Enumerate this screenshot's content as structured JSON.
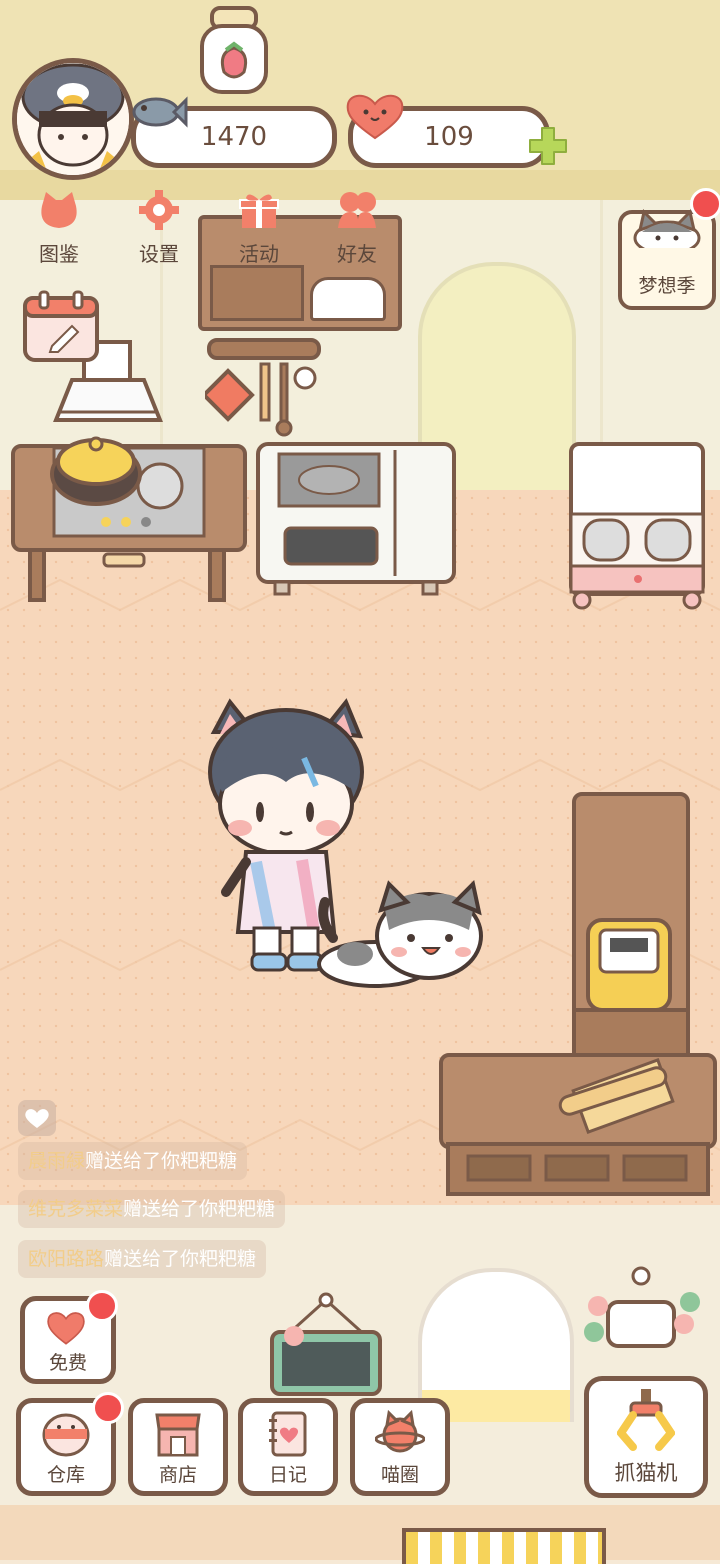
{
  "hud": {
    "fish_count": "1470",
    "heart_count": "109"
  },
  "top_menu": [
    {
      "label": "图鉴",
      "icon": "cat-head-icon"
    },
    {
      "label": "设置",
      "icon": "gear-icon"
    },
    {
      "label": "活动",
      "icon": "gift-icon"
    },
    {
      "label": "好友",
      "icon": "friends-icon"
    }
  ],
  "dream_season": {
    "label": "梦想季"
  },
  "chat_feed": [
    {
      "name": "晨雨緑",
      "text": "赠送给了你粑粑糖"
    },
    {
      "name": "维克多菜菜",
      "text": "赠送给了你粑粑糖"
    },
    {
      "name": "欧阳路路",
      "text": "赠送给了你粑粑糖"
    }
  ],
  "bottom_menu": {
    "free": "免费",
    "warehouse": "仓库",
    "shop": "商店",
    "diary": "日记",
    "meow_circle": "喵圈",
    "claw_machine": "抓猫机"
  },
  "colors": {
    "outline": "#7a5a48",
    "badge": "#f04f4f",
    "accent_coral": "#f2806a",
    "plus_green": "#b7d75a"
  }
}
